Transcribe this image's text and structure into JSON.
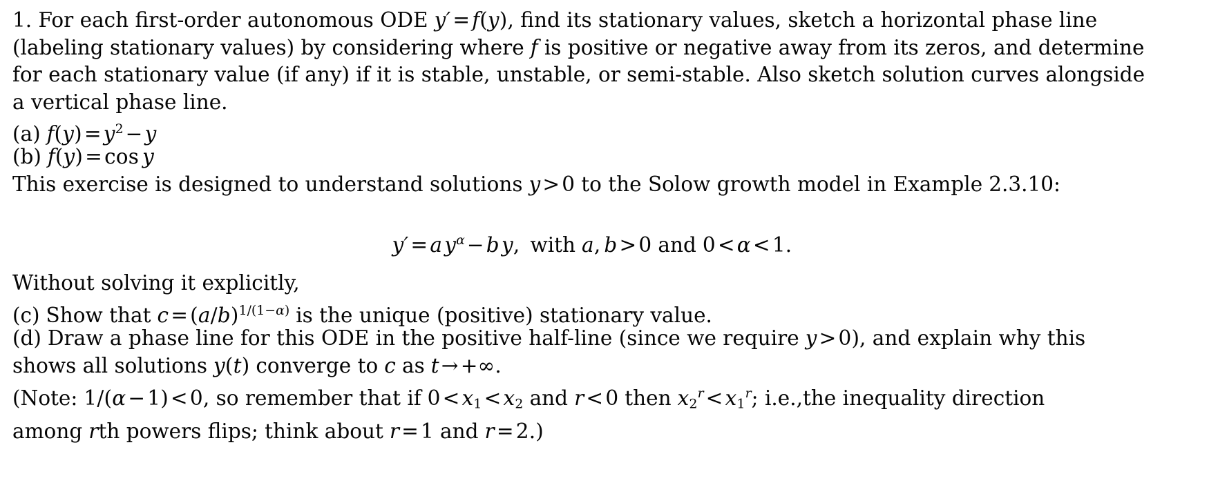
{
  "document": {
    "type": "math-exercise-sheet",
    "font_color": "#050505",
    "background": "#ffffff"
  },
  "problem": {
    "number": "1.",
    "intro_line_1": "1. For each first-order autonomous ODE",
    "intro_eq_inline": "y′ = f(y)",
    "intro_line_1b": ", find its stationary values, sketch a horizontal phase line",
    "intro_line_2a": "(labeling stationary values) by considering where",
    "intro_line_2_var": "f",
    "intro_line_2b": "is positive or negative away from its zeros, and determine",
    "intro_line_3": "for each stationary value (if any) if it is stable, unstable, or semi-stable.  Also sketch solution curves alongside",
    "intro_line_4": "a vertical phase line.",
    "full_intro_text": "1. For each first-order autonomous ODE y′ = f(y), find its stationary values, sketch a horizontal phase line (labeling stationary values) by considering where f is positive or negative away from its zeros, and determine for each stationary value (if any) if it is stable, unstable, or semi-stable.  Also sketch solution curves alongside a vertical phase line."
  },
  "items": {
    "a": {
      "label": "(a)",
      "fn": "f",
      "arg": "(y)",
      "eq": "=",
      "rhs_base": "y",
      "rhs_exp": "2",
      "minus": "−",
      "rhs_term2": "y",
      "text": "(a) f(y) = y² − y"
    },
    "b": {
      "label": "(b)",
      "fn": "f",
      "arg": "(y)",
      "eq": "=",
      "rhs": "cos",
      "rhs_var": "y",
      "text": "(b) f(y) = cos y"
    },
    "c": {
      "label": "(c)",
      "text_before": "Show that",
      "var_c": "c",
      "eq": "=",
      "base": "(a/b)",
      "exponent": "1/(1−α)",
      "text_after": "is the unique (positive) stationary value.",
      "text": "(c) Show that c = (a/b)^{1/(1−α)} is the unique (positive) stationary value."
    },
    "d": {
      "label": "(d)",
      "text_line1a": "Draw a phase line for this ODE in the positive half-line (since we require",
      "cond": "y > 0",
      "text_line1b": "), and explain why this",
      "text_line2a": "shows all solutions",
      "yt": "y(t)",
      "text_line2b": "converge to",
      "var_c": "c",
      "as_word": "as",
      "limit": "t → +∞",
      "period": ".",
      "text": "(d) Draw a phase line for this ODE in the positive half-line (since we require y > 0), and explain why this shows all solutions y(t) converge to c as t → +∞."
    }
  },
  "solow": {
    "lead_in_a": "This exercise is designed to understand solutions",
    "lead_in_cond": "y > 0",
    "lead_in_b": "to the Solow growth model in Example",
    "example_number": "2.3.10:",
    "lead_in_full": "This exercise is designed to understand solutions y > 0 to the Solow growth model in Example 2.3.10:",
    "equation": {
      "lhs": "y′",
      "eq": "=",
      "term1_coef": "a",
      "term1_base": "y",
      "term1_exp": "α",
      "minus": "−",
      "term2_coef": "b",
      "term2_base": "y",
      "comma": ",",
      "with_word": "with",
      "params": "a, b > 0",
      "and_word": "and",
      "alpha_range": "0 < α < 1.",
      "plain": "y′ = ay^α − by,  with a, b > 0 and 0 < α < 1."
    },
    "without_solving": "Without solving it explicitly,"
  },
  "note": {
    "open": "(Note:",
    "ineq1": "1/(α − 1) < 0",
    "text1": ", so remember that if",
    "ineq2": "0 < x₁ < x₂",
    "and_word": "and",
    "ineq3": "r < 0",
    "then_word": "then",
    "ineq4": "x₂ʳ < x₁ʳ",
    "text2": "; i.e.,the inequality direction",
    "line2a": "among",
    "rth": "r",
    "line2b": "th powers flips; think about",
    "r1": "r = 1",
    "and2": "and",
    "r2": "r = 2.)",
    "full": "(Note: 1/(α − 1) < 0, so remember that if 0 < x₁ < x₂ and r < 0 then x₂ʳ < x₁ʳ; i.e.,the inequality direction among rth powers flips; think about r = 1 and r = 2.)"
  }
}
